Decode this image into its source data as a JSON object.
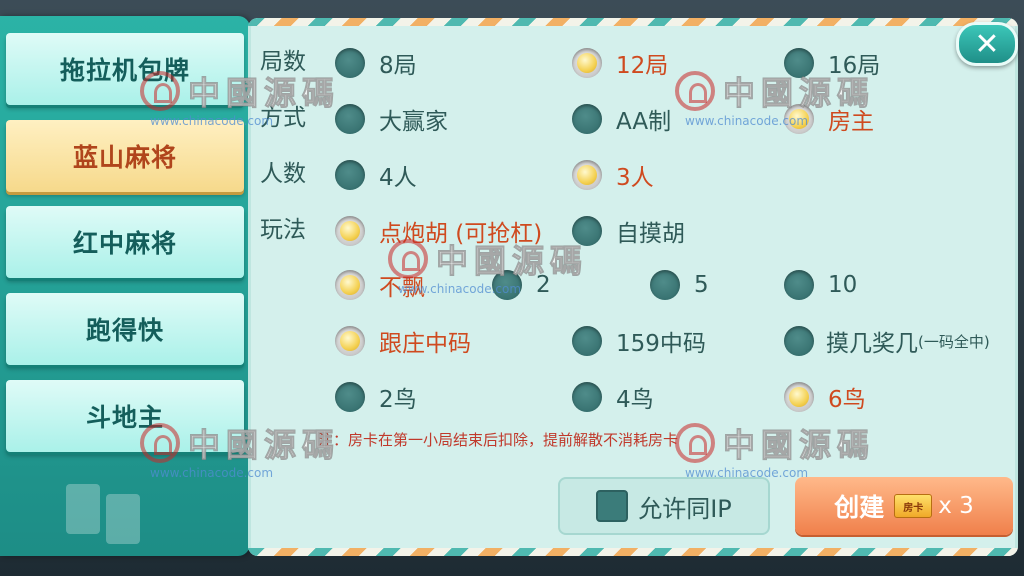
{
  "sidebar": {
    "tabs": [
      {
        "label": "拖拉机包牌"
      },
      {
        "label": "蓝山麻将"
      },
      {
        "label": "红中麻将"
      },
      {
        "label": "跑得快"
      },
      {
        "label": "斗地主"
      }
    ],
    "active_index": 1
  },
  "rows": {
    "rounds": {
      "label": "局数",
      "options": [
        "8局",
        "12局",
        "16局"
      ],
      "selected": 1
    },
    "mode": {
      "label": "方式",
      "options": [
        "大赢家",
        "AA制",
        "房主"
      ],
      "selected": 2
    },
    "players": {
      "label": "人数",
      "options": [
        "4人",
        "3人"
      ],
      "selected": 1
    },
    "play": {
      "label": "玩法",
      "options": [
        "点炮胡 (可抢杠)",
        "自摸胡"
      ],
      "selected": 0
    },
    "piao": {
      "options": [
        "不飘",
        "2",
        "5",
        "10"
      ],
      "selected": 0
    },
    "zhongma": {
      "options": [
        "跟庄中码",
        "159中码",
        "摸几奖几",
        "(一码全中)"
      ],
      "selected": 0
    },
    "niao": {
      "options": [
        "2鸟",
        "4鸟",
        "6鸟"
      ],
      "selected": 2
    }
  },
  "notice": "注：房卡在第一小局结束后扣除，提前解散不消耗房卡",
  "buttons": {
    "allow_same_ip": "允许同IP",
    "create": "创建",
    "card_icon_text": "房卡",
    "create_count": "x 3",
    "close_glyph": "✕"
  },
  "watermark": {
    "text": "中國源碼",
    "url": "www.chinacode.com"
  },
  "colors": {
    "accent_teal": "#23a79c",
    "selected_text": "#cf4a1f",
    "active_tab": "#f6d98b",
    "create_button": "#f0804b"
  }
}
